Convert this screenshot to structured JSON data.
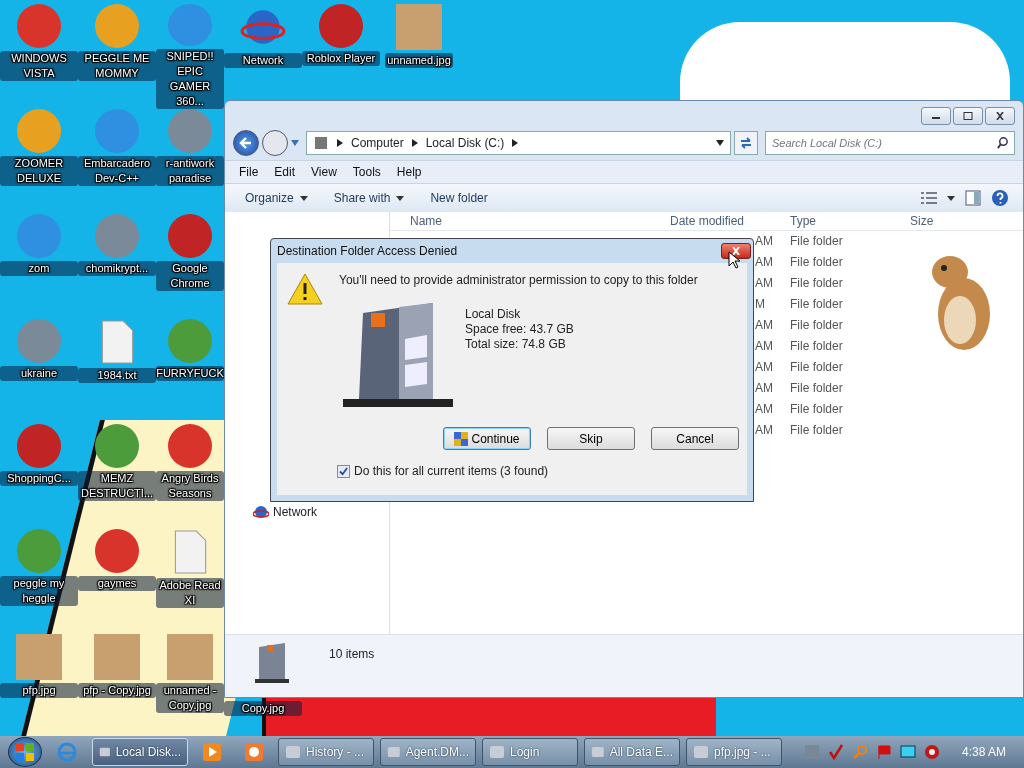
{
  "desktop": {
    "icon_rows": [
      [
        {
          "label": "WINDOWS VISTA",
          "kind": "app"
        },
        {
          "label": "PEGGLE ME MOMMY",
          "kind": "app"
        },
        {
          "label": "SNIPED!! EPIC GAMER 360...",
          "kind": "app"
        },
        {
          "label": "Network",
          "kind": "network"
        },
        {
          "label": "Roblox Player",
          "kind": "app"
        },
        {
          "label": "unnamed.jpg",
          "kind": "photo"
        }
      ],
      [
        {
          "label": "ZOOMER DELUXE",
          "kind": "app"
        },
        {
          "label": "Embarcadero Dev-C++",
          "kind": "app"
        },
        {
          "label": "r-antiwork paradise",
          "kind": "app"
        }
      ],
      [
        {
          "label": "zom",
          "kind": "app"
        },
        {
          "label": "chomikrypt...",
          "kind": "app"
        },
        {
          "label": "Google Chrome",
          "kind": "app"
        }
      ],
      [
        {
          "label": "ukraine",
          "kind": "app"
        },
        {
          "label": "1984.txt",
          "kind": "document"
        },
        {
          "label": "FURRYFUCK",
          "kind": "app"
        }
      ],
      [
        {
          "label": "ShoppingC...",
          "kind": "app"
        },
        {
          "label": "MEMZ DESTRUCTI...",
          "kind": "app"
        },
        {
          "label": "Angry Birds Seasons",
          "kind": "app"
        }
      ],
      [
        {
          "label": "peggle my heggle",
          "kind": "app"
        },
        {
          "label": "gaymes",
          "kind": "app"
        },
        {
          "label": "Adobe Read XI",
          "kind": "document"
        }
      ],
      [
        {
          "label": "pfp.jpg",
          "kind": "photo"
        },
        {
          "label": "pfp - Copy.jpg",
          "kind": "photo"
        },
        {
          "label": "unnamed - Copy.jpg",
          "kind": "photo"
        },
        {
          "label": "Copy.jpg",
          "kind": "label-only"
        }
      ]
    ]
  },
  "explorer": {
    "breadcrumb": [
      "Computer",
      "Local Disk (C:)"
    ],
    "search": {
      "placeholder": "Search Local Disk (C:)"
    },
    "menu": [
      "File",
      "Edit",
      "View",
      "Tools",
      "Help"
    ],
    "toolbar": [
      {
        "label": "Organize",
        "dropdown": true
      },
      {
        "label": "Share with",
        "dropdown": true
      },
      {
        "label": "New folder",
        "dropdown": false
      }
    ],
    "columns": [
      "Name",
      "Date modified",
      "Type",
      "Size"
    ],
    "nav_items": [
      "Network"
    ],
    "rows": [
      {
        "date": "AM",
        "type": "File folder"
      },
      {
        "date": "AM",
        "type": "File folder"
      },
      {
        "date": "AM",
        "type": "File folder"
      },
      {
        "date": "M",
        "type": "File folder"
      },
      {
        "date": "AM",
        "type": "File folder"
      },
      {
        "date": "AM",
        "type": "File folder"
      },
      {
        "date": "AM",
        "type": "File folder"
      },
      {
        "date": "AM",
        "type": "File folder"
      },
      {
        "date": "AM",
        "type": "File folder"
      },
      {
        "date": "AM",
        "type": "File folder"
      }
    ],
    "status": "10 items"
  },
  "dialog": {
    "title": "Destination Folder Access Denied",
    "message": "You'll need to provide administrator permission to copy to this folder",
    "drive": [
      "Local Disk",
      "Space free: 43.7 GB",
      "Total size: 74.8 GB"
    ],
    "buttons": [
      {
        "label": "Continue",
        "kind": "shield"
      },
      {
        "label": "Skip",
        "kind": "plain"
      },
      {
        "label": "Cancel",
        "kind": "plain"
      }
    ],
    "apply_all": {
      "label": "Do this for all current items (3 found)",
      "checked": true
    }
  },
  "taskbar": {
    "items": [
      {
        "label": "Local Disk...",
        "selected": true
      },
      {
        "label": "History - ...",
        "selected": false
      },
      {
        "label": "Agent.DM...",
        "selected": false
      },
      {
        "label": "Login",
        "selected": false
      },
      {
        "label": "All Data E...",
        "selected": false
      },
      {
        "label": "pfp.jpg - ...",
        "selected": false
      }
    ],
    "clock": "4:38 AM"
  }
}
